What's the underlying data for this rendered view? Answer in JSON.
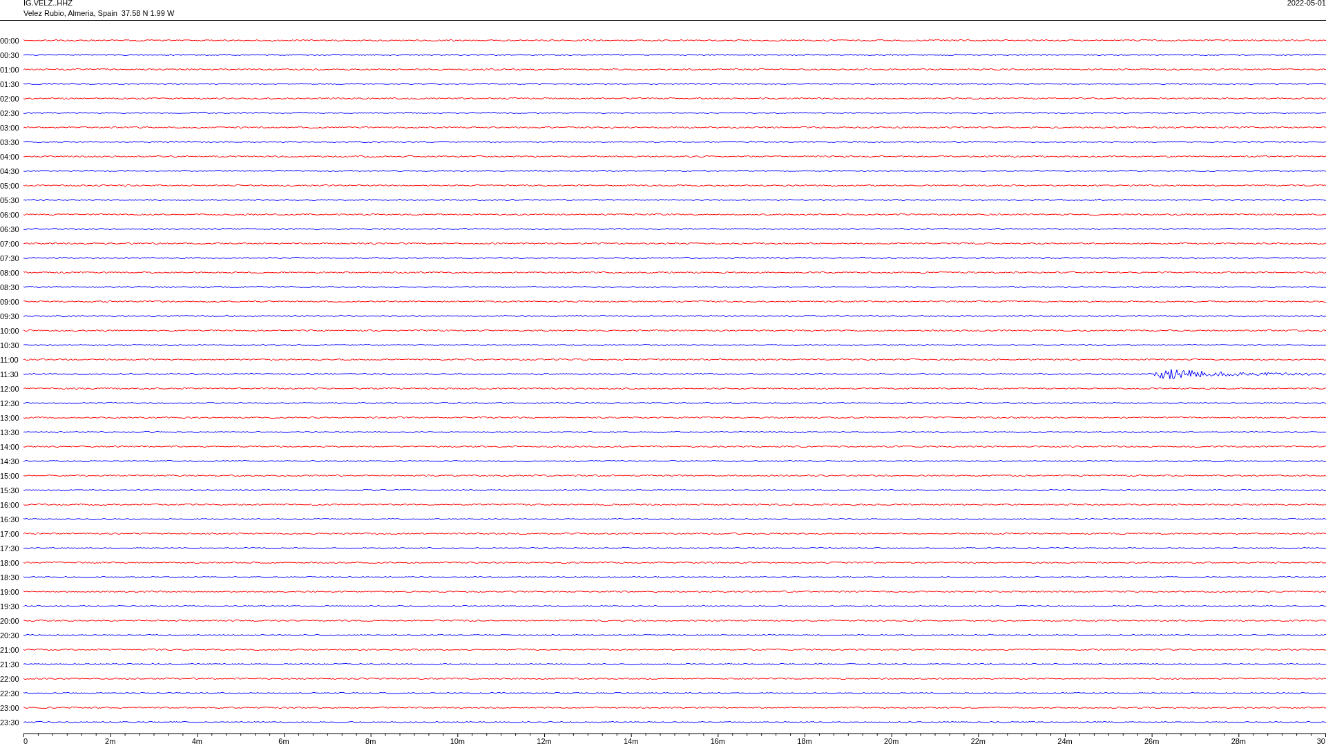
{
  "header": {
    "station": "IG.VELZ..HHZ",
    "location": "Velez Rubio, Almeria, Spain  37.58 N 1.99 W",
    "date": "2022-05-01"
  },
  "traces": [
    {
      "time": "00:00",
      "color": "#ff0000",
      "kind": "quiet"
    },
    {
      "time": "00:30",
      "color": "#0000ff",
      "kind": "quiet"
    },
    {
      "time": "01:00",
      "color": "#ff0000",
      "kind": "quiet"
    },
    {
      "time": "01:30",
      "color": "#0000ff",
      "kind": "quiet"
    },
    {
      "time": "02:00",
      "color": "#ff0000",
      "kind": "quiet"
    },
    {
      "time": "02:30",
      "color": "#0000ff",
      "kind": "quiet"
    },
    {
      "time": "03:00",
      "color": "#ff0000",
      "kind": "quiet"
    },
    {
      "time": "03:30",
      "color": "#0000ff",
      "kind": "quiet"
    },
    {
      "time": "04:00",
      "color": "#ff0000",
      "kind": "quiet"
    },
    {
      "time": "04:30",
      "color": "#0000ff",
      "kind": "quiet"
    },
    {
      "time": "05:00",
      "color": "#ff0000",
      "kind": "quiet"
    },
    {
      "time": "05:30",
      "color": "#0000ff",
      "kind": "quiet"
    },
    {
      "time": "06:00",
      "color": "#ff0000",
      "kind": "quiet"
    },
    {
      "time": "06:30",
      "color": "#0000ff",
      "kind": "quiet"
    },
    {
      "time": "07:00",
      "color": "#ff0000",
      "kind": "quiet"
    },
    {
      "time": "07:30",
      "color": "#0000ff",
      "kind": "quiet"
    },
    {
      "time": "08:00",
      "color": "#ff0000",
      "kind": "quiet"
    },
    {
      "time": "08:30",
      "color": "#0000ff",
      "kind": "quiet"
    },
    {
      "time": "09:00",
      "color": "#ff0000",
      "kind": "quiet"
    },
    {
      "time": "09:30",
      "color": "#0000ff",
      "kind": "quiet"
    },
    {
      "time": "10:00",
      "color": "#ff0000",
      "kind": "quiet"
    },
    {
      "time": "10:30",
      "color": "#0000ff",
      "kind": "quiet"
    },
    {
      "time": "11:00",
      "color": "#ff0000",
      "kind": "quiet"
    },
    {
      "time": "11:30",
      "color": "#0000ff",
      "kind": "event"
    },
    {
      "time": "12:00",
      "color": "#ff0000",
      "kind": "quiet"
    },
    {
      "time": "12:30",
      "color": "#0000ff",
      "kind": "quiet"
    },
    {
      "time": "13:00",
      "color": "#ff0000",
      "kind": "quiet"
    },
    {
      "time": "13:30",
      "color": "#0000ff",
      "kind": "quiet"
    },
    {
      "time": "14:00",
      "color": "#ff0000",
      "kind": "quiet"
    },
    {
      "time": "14:30",
      "color": "#0000ff",
      "kind": "quiet"
    },
    {
      "time": "15:00",
      "color": "#ff0000",
      "kind": "quiet"
    },
    {
      "time": "15:30",
      "color": "#0000ff",
      "kind": "quiet"
    },
    {
      "time": "16:00",
      "color": "#ff0000",
      "kind": "quiet"
    },
    {
      "time": "16:30",
      "color": "#0000ff",
      "kind": "quiet"
    },
    {
      "time": "17:00",
      "color": "#ff0000",
      "kind": "quiet"
    },
    {
      "time": "17:30",
      "color": "#0000ff",
      "kind": "quiet"
    },
    {
      "time": "18:00",
      "color": "#ff0000",
      "kind": "quiet"
    },
    {
      "time": "18:30",
      "color": "#0000ff",
      "kind": "quiet"
    },
    {
      "time": "19:00",
      "color": "#ff0000",
      "kind": "quiet"
    },
    {
      "time": "19:30",
      "color": "#0000ff",
      "kind": "quiet"
    },
    {
      "time": "20:00",
      "color": "#ff0000",
      "kind": "quiet"
    },
    {
      "time": "20:30",
      "color": "#0000ff",
      "kind": "quiet"
    },
    {
      "time": "21:00",
      "color": "#ff0000",
      "kind": "quiet"
    },
    {
      "time": "21:30",
      "color": "#0000ff",
      "kind": "quiet"
    },
    {
      "time": "22:00",
      "color": "#ff0000",
      "kind": "quiet"
    },
    {
      "time": "22:30",
      "color": "#0000ff",
      "kind": "quiet"
    },
    {
      "time": "23:00",
      "color": "#ff0000",
      "kind": "quiet"
    },
    {
      "time": "23:30",
      "color": "#0000ff",
      "kind": "quiet"
    }
  ],
  "axis": {
    "ticks": [
      "0",
      "2m",
      "4m",
      "6m",
      "8m",
      "10m",
      "12m",
      "14m",
      "16m",
      "18m",
      "20m",
      "22m",
      "24m",
      "26m",
      "28m",
      "30"
    ]
  }
}
